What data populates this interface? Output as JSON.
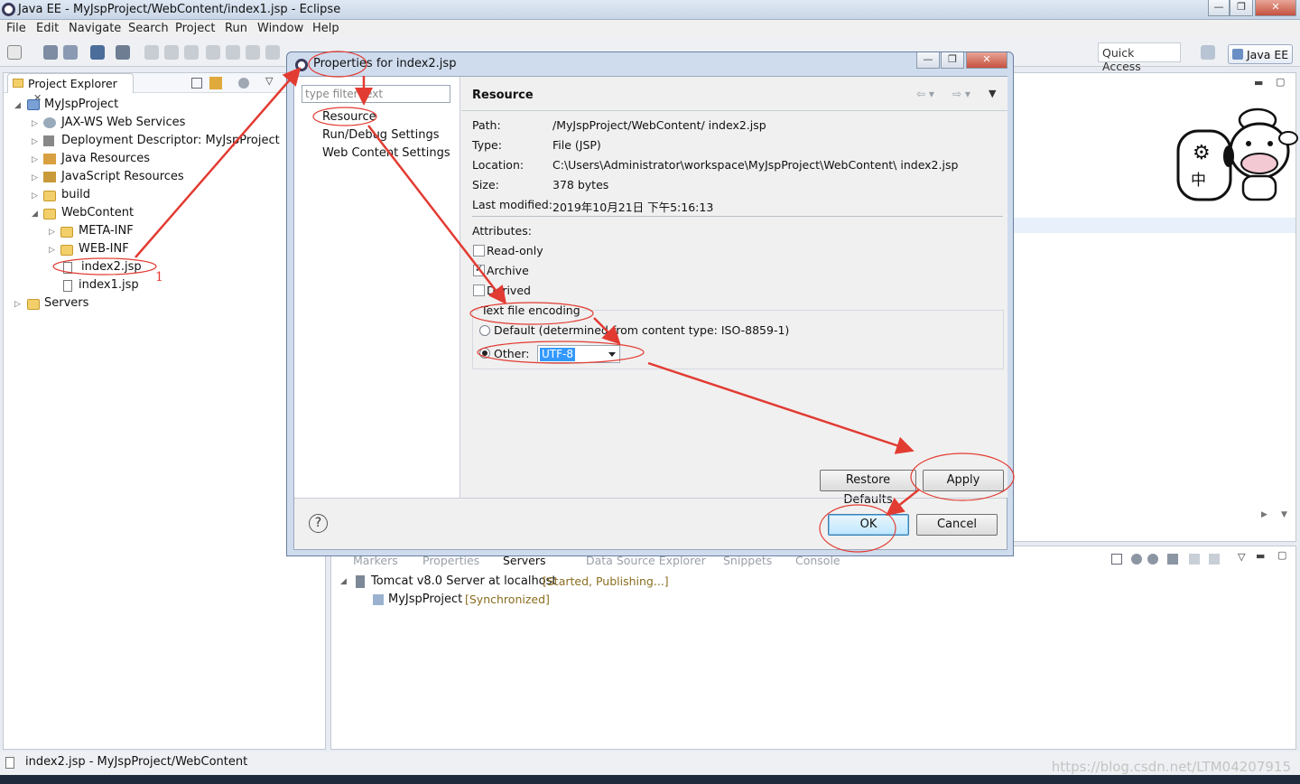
{
  "window": {
    "title": "Java EE - MyJspProject/WebContent/index1.jsp - Eclipse",
    "min_glyph": "—",
    "max_glyph": "❐",
    "close_glyph": "✕"
  },
  "menu": [
    "File",
    "Edit",
    "Navigate",
    "Search",
    "Project",
    "Run",
    "Window",
    "Help"
  ],
  "toolbar": {
    "quick_access": "Quick Access",
    "perspective": "Java EE"
  },
  "explorer": {
    "tab_label": "Project Explorer",
    "tab_close": "✕",
    "tree": {
      "project": "MyJspProject",
      "jaxws": "JAX-WS Web Services",
      "deployment": "Deployment Descriptor: MyJspProject",
      "java_resources": "Java Resources",
      "js_resources": "JavaScript Resources",
      "build": "build",
      "webcontent": "WebContent",
      "metainf": "META-INF",
      "webinf": "WEB-INF",
      "index2": "index2.jsp",
      "index1": "index1.jsp",
      "servers": "Servers"
    },
    "annotation_number": "1"
  },
  "dialog": {
    "title": "Properties for  index2.jsp",
    "filter_placeholder": "type filter text",
    "nav": [
      "Resource",
      "Run/Debug Settings",
      "Web Content Settings"
    ],
    "heading": "Resource",
    "fields": {
      "path_label": "Path:",
      "path_value": "/MyJspProject/WebContent/ index2.jsp",
      "type_label": "Type:",
      "type_value": "File  (JSP)",
      "location_label": "Location:",
      "location_value": "C:\\Users\\Administrator\\workspace\\MyJspProject\\WebContent\\ index2.jsp",
      "size_label": "Size:",
      "size_value": "378  bytes",
      "modified_label": "Last modified:",
      "modified_value": "2019年10月21日 下午5:16:13"
    },
    "attributes_label": "Attributes:",
    "read_only": "Read-only",
    "archive": "Archive",
    "derived": "Derived",
    "encoding_group": "Text file encoding",
    "default_option": "Default (determined from content type: ISO-8859-1)",
    "other_option": "Other:",
    "encoding_value": "UTF-8",
    "restore_defaults": "Restore Defaults",
    "apply": "Apply",
    "ok": "OK",
    "cancel": "Cancel",
    "help": "?"
  },
  "bottom_panel": {
    "tabs": [
      "Markers",
      "Properties",
      "Servers",
      "Data Source Explorer",
      "Snippets",
      "Console"
    ],
    "server_name": "Tomcat v8.0 Server at localhost",
    "server_status": "[Started, Publishing...]",
    "module_name": "MyJspProject",
    "module_status": "[Synchronized]"
  },
  "status_bar": {
    "text": "index2.jsp - MyJspProject/WebContent"
  },
  "watermark": "https://blog.csdn.net/LTM04207915",
  "mascot": {
    "gear": "⚙",
    "char": "中"
  },
  "colors": {
    "annotation_red": "#e23b32",
    "selection_blue": "#3399ff"
  }
}
